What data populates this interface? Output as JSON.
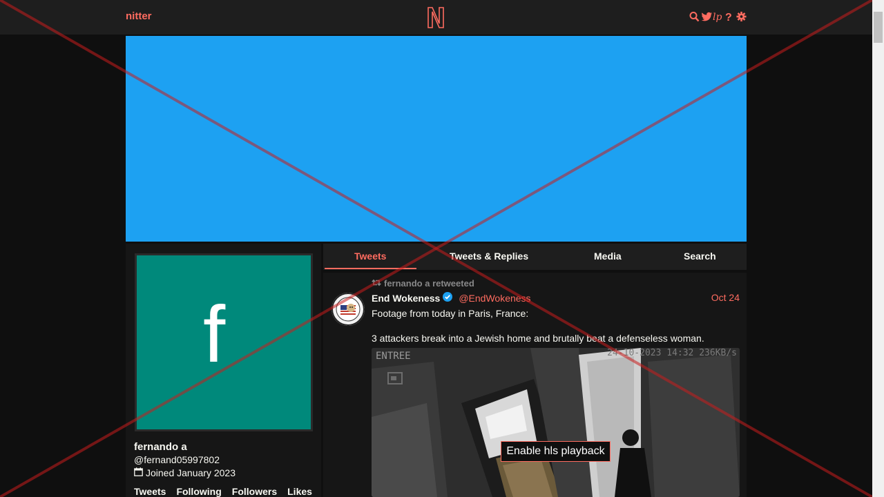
{
  "nav": {
    "brand": "nitter",
    "logo_letter": "N",
    "icons": [
      "search-icon",
      "bird-icon",
      "lp-icon",
      "help-icon",
      "settings-icon"
    ]
  },
  "profile": {
    "fullname": "fernando a",
    "username": "@fernand05997802",
    "joined": "Joined January 2023",
    "avatar_letter": "f",
    "stats": [
      "Tweets",
      "Following",
      "Followers",
      "Likes"
    ]
  },
  "tabs": [
    "Tweets",
    "Tweets & Replies",
    "Media",
    "Search"
  ],
  "tweet": {
    "retweet_label": "fernando a retweeted",
    "author_name": "End Wokeness",
    "author_handle": "@EndWokeness",
    "date": "Oct 24",
    "paragraphs": [
      "Footage from today in Paris, France:",
      "3 attackers break into a Jewish home and brutally beat a defenseless woman."
    ],
    "video": {
      "cctv_label": "ENTREE",
      "cctv_timestamp": "24-10-2023 14:32 236KB/s",
      "hls_button": "Enable hls playback"
    }
  },
  "colors": {
    "accent": "#ff6c60",
    "banner": "#1da1f2",
    "avatar_bg": "#00897b",
    "background": "#0f0f0f"
  }
}
